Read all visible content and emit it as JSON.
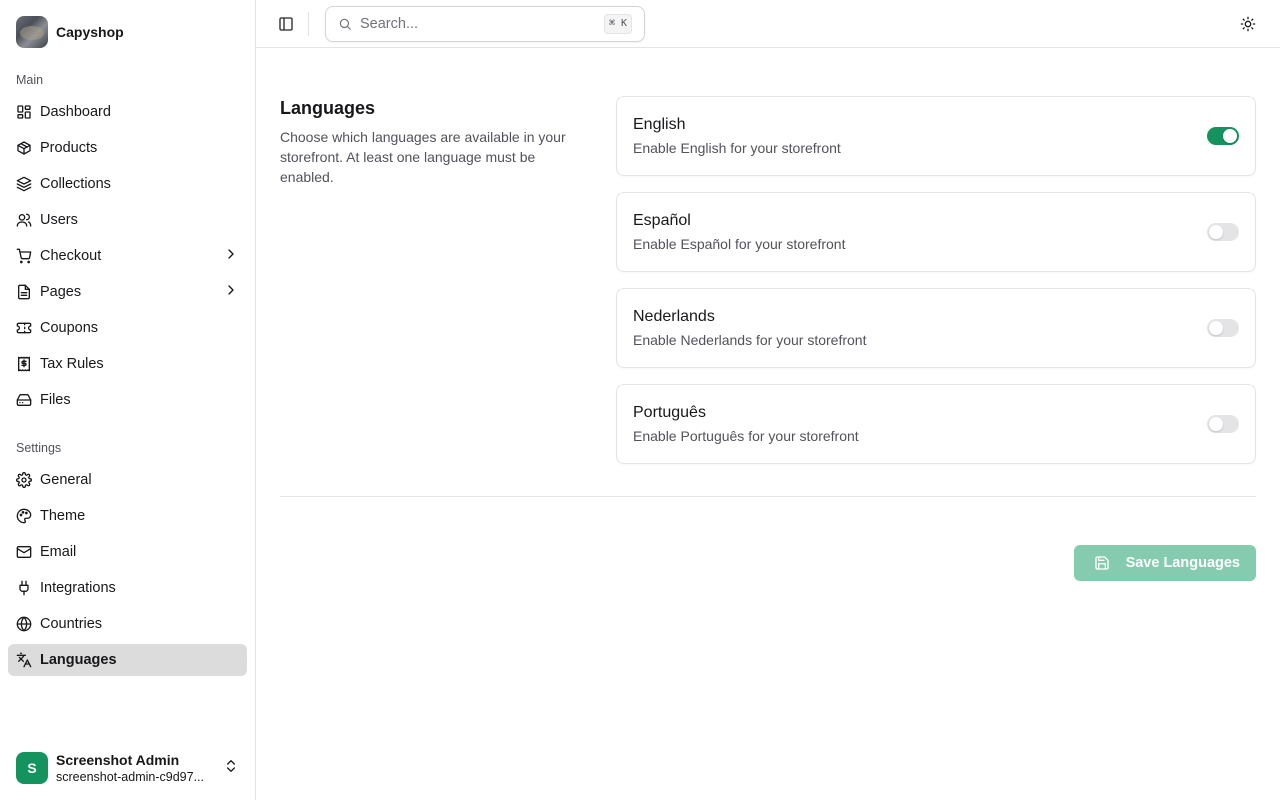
{
  "brand": {
    "name": "Capyshop"
  },
  "sidebar": {
    "main_label": "Main",
    "main_items": [
      {
        "label": "Dashboard",
        "icon": "dashboard-icon"
      },
      {
        "label": "Products",
        "icon": "package-icon"
      },
      {
        "label": "Collections",
        "icon": "layers-icon"
      },
      {
        "label": "Users",
        "icon": "user-icon"
      },
      {
        "label": "Checkout",
        "icon": "cart-icon",
        "has_submenu": true
      },
      {
        "label": "Pages",
        "icon": "file-icon",
        "has_submenu": true
      },
      {
        "label": "Coupons",
        "icon": "ticket-icon"
      },
      {
        "label": "Tax Rules",
        "icon": "receipt-dollar-icon"
      },
      {
        "label": "Files",
        "icon": "hard-drive-icon"
      }
    ],
    "settings_label": "Settings",
    "settings_items": [
      {
        "label": "General",
        "icon": "gear-icon"
      },
      {
        "label": "Theme",
        "icon": "palette-icon"
      },
      {
        "label": "Email",
        "icon": "mail-icon"
      },
      {
        "label": "Integrations",
        "icon": "plug-icon"
      },
      {
        "label": "Countries",
        "icon": "globe-icon"
      },
      {
        "label": "Languages",
        "icon": "languages-icon",
        "active": true
      }
    ],
    "user": {
      "initial": "S",
      "name": "Screenshot Admin",
      "email": "screenshot-admin-c9d97..."
    }
  },
  "topbar": {
    "search_placeholder": "Search...",
    "search_shortcut": "⌘ K"
  },
  "languages": {
    "title": "Languages",
    "description": "Choose which languages are available in your storefront. At least one language must be enabled.",
    "items": [
      {
        "name": "English",
        "description": "Enable English for your storefront",
        "enabled": true
      },
      {
        "name": "Español",
        "description": "Enable Español for your storefront",
        "enabled": false
      },
      {
        "name": "Nederlands",
        "description": "Enable Nederlands for your storefront",
        "enabled": false
      },
      {
        "name": "Português",
        "description": "Enable Português for your storefront",
        "enabled": false
      }
    ],
    "save_label": "Save Languages"
  },
  "colors": {
    "accent": "#15935f",
    "accent_disabled": "#84cbb0",
    "active_nav_bg": "#dcdcdc"
  }
}
